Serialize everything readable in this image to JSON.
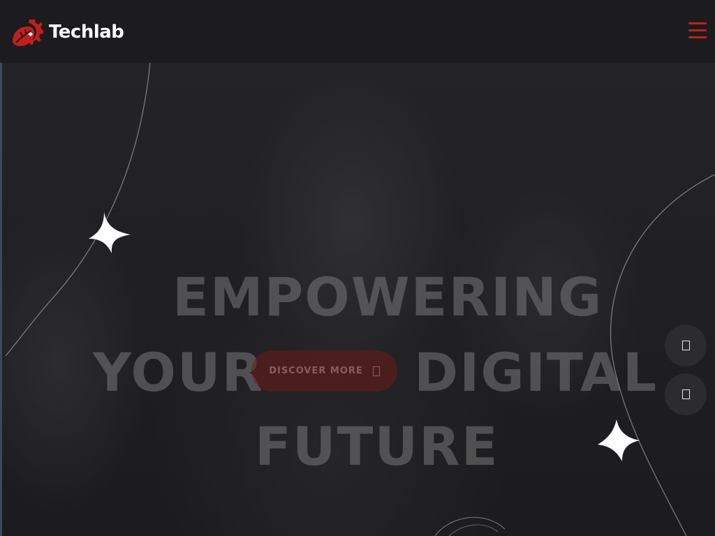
{
  "header": {
    "brand": "Techlab",
    "menu_icon": "hamburger-menu-icon",
    "logo_icon": "gear-leaf-logo-icon",
    "accent_color": "#c0201b"
  },
  "hero": {
    "title_line1": "EMPOWERING",
    "title_line2a": "YOUR",
    "title_line2b": "DIGITAL",
    "title_line3": "FUTURE",
    "cta_label": "DISCOVER MORE",
    "cta_icon": "arrow-right-icon",
    "prev_icon": "chevron-left-icon",
    "next_icon": "chevron-right-icon",
    "decor_icon": "sparkle-star-icon"
  }
}
